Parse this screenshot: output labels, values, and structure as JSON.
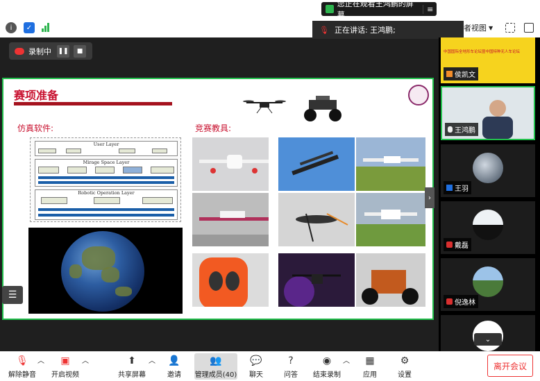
{
  "watch_banner": "您正在观看王鸿鹏的屏幕",
  "speaking": "正在讲话: 王鸿鹏;",
  "view_label": "者视图",
  "record_label": "录制中",
  "slide": {
    "title": "赛项准备",
    "left_heading": "仿真软件:",
    "right_heading": "竞赛教具:",
    "layers": [
      {
        "name": "User Layer"
      },
      {
        "name": "Mirage Space Layer"
      },
      {
        "name": "Robotic Operation Layer"
      }
    ]
  },
  "participants": [
    {
      "name": "侯凯文",
      "banner": "中国国际全地形车论坛暨中国特种无人车论坛"
    },
    {
      "name": "王鸿鹏"
    },
    {
      "name": "王羽"
    },
    {
      "name": "戴磊"
    },
    {
      "name": "倪逸林"
    }
  ],
  "toolbar": {
    "unmute": "解除静音",
    "video": "开启视频",
    "share": "共享屏幕",
    "invite": "邀请",
    "members": "管理成员(40)",
    "chat": "聊天",
    "qa": "问答",
    "end_record": "结束录制",
    "apps": "应用",
    "settings": "设置",
    "leave": "离开会议"
  }
}
